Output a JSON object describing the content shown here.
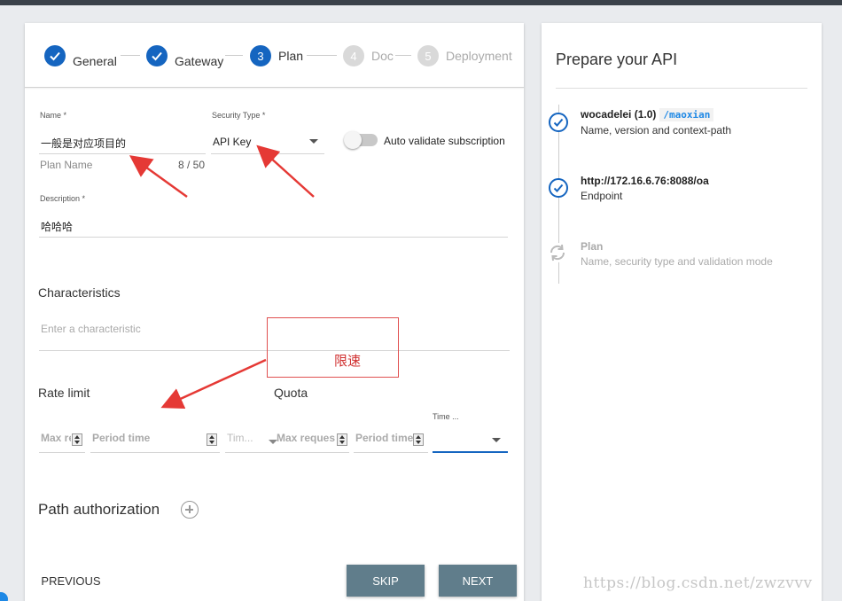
{
  "stepper": {
    "steps": [
      {
        "number": "✓",
        "label": "General",
        "state": "done"
      },
      {
        "number": "✓",
        "label": "Gateway",
        "state": "done"
      },
      {
        "number": "3",
        "label": "Plan",
        "state": "active"
      },
      {
        "number": "4",
        "label": "Doc",
        "state": "pending"
      },
      {
        "number": "5",
        "label": "Deployment",
        "state": "pending"
      }
    ]
  },
  "form": {
    "name_label": "Name *",
    "name_value": "一般是对应项目的",
    "name_hint": "Plan Name",
    "name_counter": "8 / 50",
    "security_label": "Security Type *",
    "security_value": "API Key",
    "auto_validate_label": "Auto validate subscription",
    "description_label": "Description *",
    "description_value": "哈哈哈",
    "characteristics_title": "Characteristics",
    "characteristic_placeholder": "Enter a characteristic",
    "rate_limit_title": "Rate limit",
    "quota_title": "Quota",
    "rate_max_requests": "Max re",
    "rate_period_time": "Period time",
    "rate_time_unit": "Tim...",
    "quota_max_requests": "Max reques",
    "quota_period_time": "Period time",
    "quota_time_unit_label": "Time ...",
    "path_auth_title": "Path authorization"
  },
  "buttons": {
    "previous": "PREVIOUS",
    "skip": "SKIP",
    "next": "NEXT"
  },
  "summary": {
    "title": "Prepare your API",
    "items": [
      {
        "title": "wocadelei (1.0)",
        "context_path": "/maoxian",
        "subtitle": "Name, version and context-path",
        "state": "done"
      },
      {
        "title": "http://172.16.6.76:8088/oa",
        "subtitle": "Endpoint",
        "state": "done"
      },
      {
        "title": "Plan",
        "subtitle": "Name, security type and validation mode",
        "state": "pending"
      }
    ]
  },
  "annotation": {
    "text": "限速"
  },
  "watermark": "https://blog.csdn.net/zwzvvv",
  "colors": {
    "accent": "#1565c0",
    "button": "#607d8b",
    "annotation": "#e03030"
  }
}
